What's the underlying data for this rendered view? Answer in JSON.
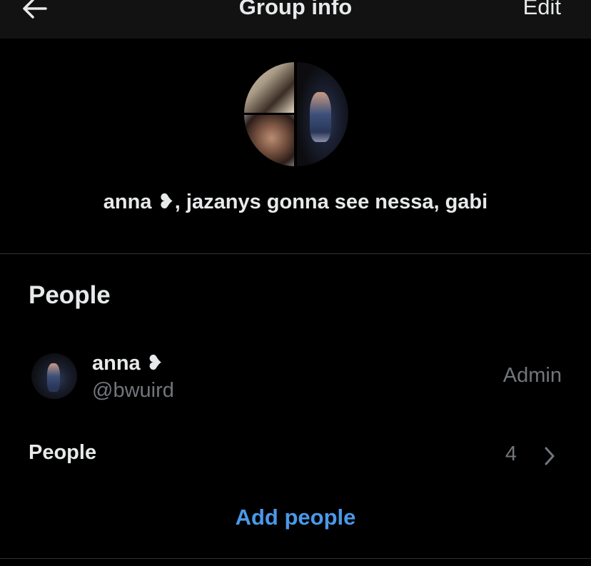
{
  "header": {
    "title": "Group info",
    "edit_label": "Edit",
    "back_icon": "arrow-left-icon"
  },
  "group": {
    "name": "anna ❥, jazanys gonna see nessa, gabi",
    "avatar_icon": "group-avatar-collage"
  },
  "people_section": {
    "title": "People",
    "members": [
      {
        "name": "anna ❥",
        "handle": "@bwuird",
        "role": "Admin"
      }
    ],
    "people_row_label": "People",
    "people_count": "4",
    "chevron_icon": "chevron-right-icon",
    "add_people_label": "Add people"
  },
  "colors": {
    "background": "#000000",
    "header_background": "#121212",
    "primary_text": "#e7e9ea",
    "secondary_text": "#71767b",
    "accent": "#4a99e9",
    "divider": "#2f3336"
  }
}
